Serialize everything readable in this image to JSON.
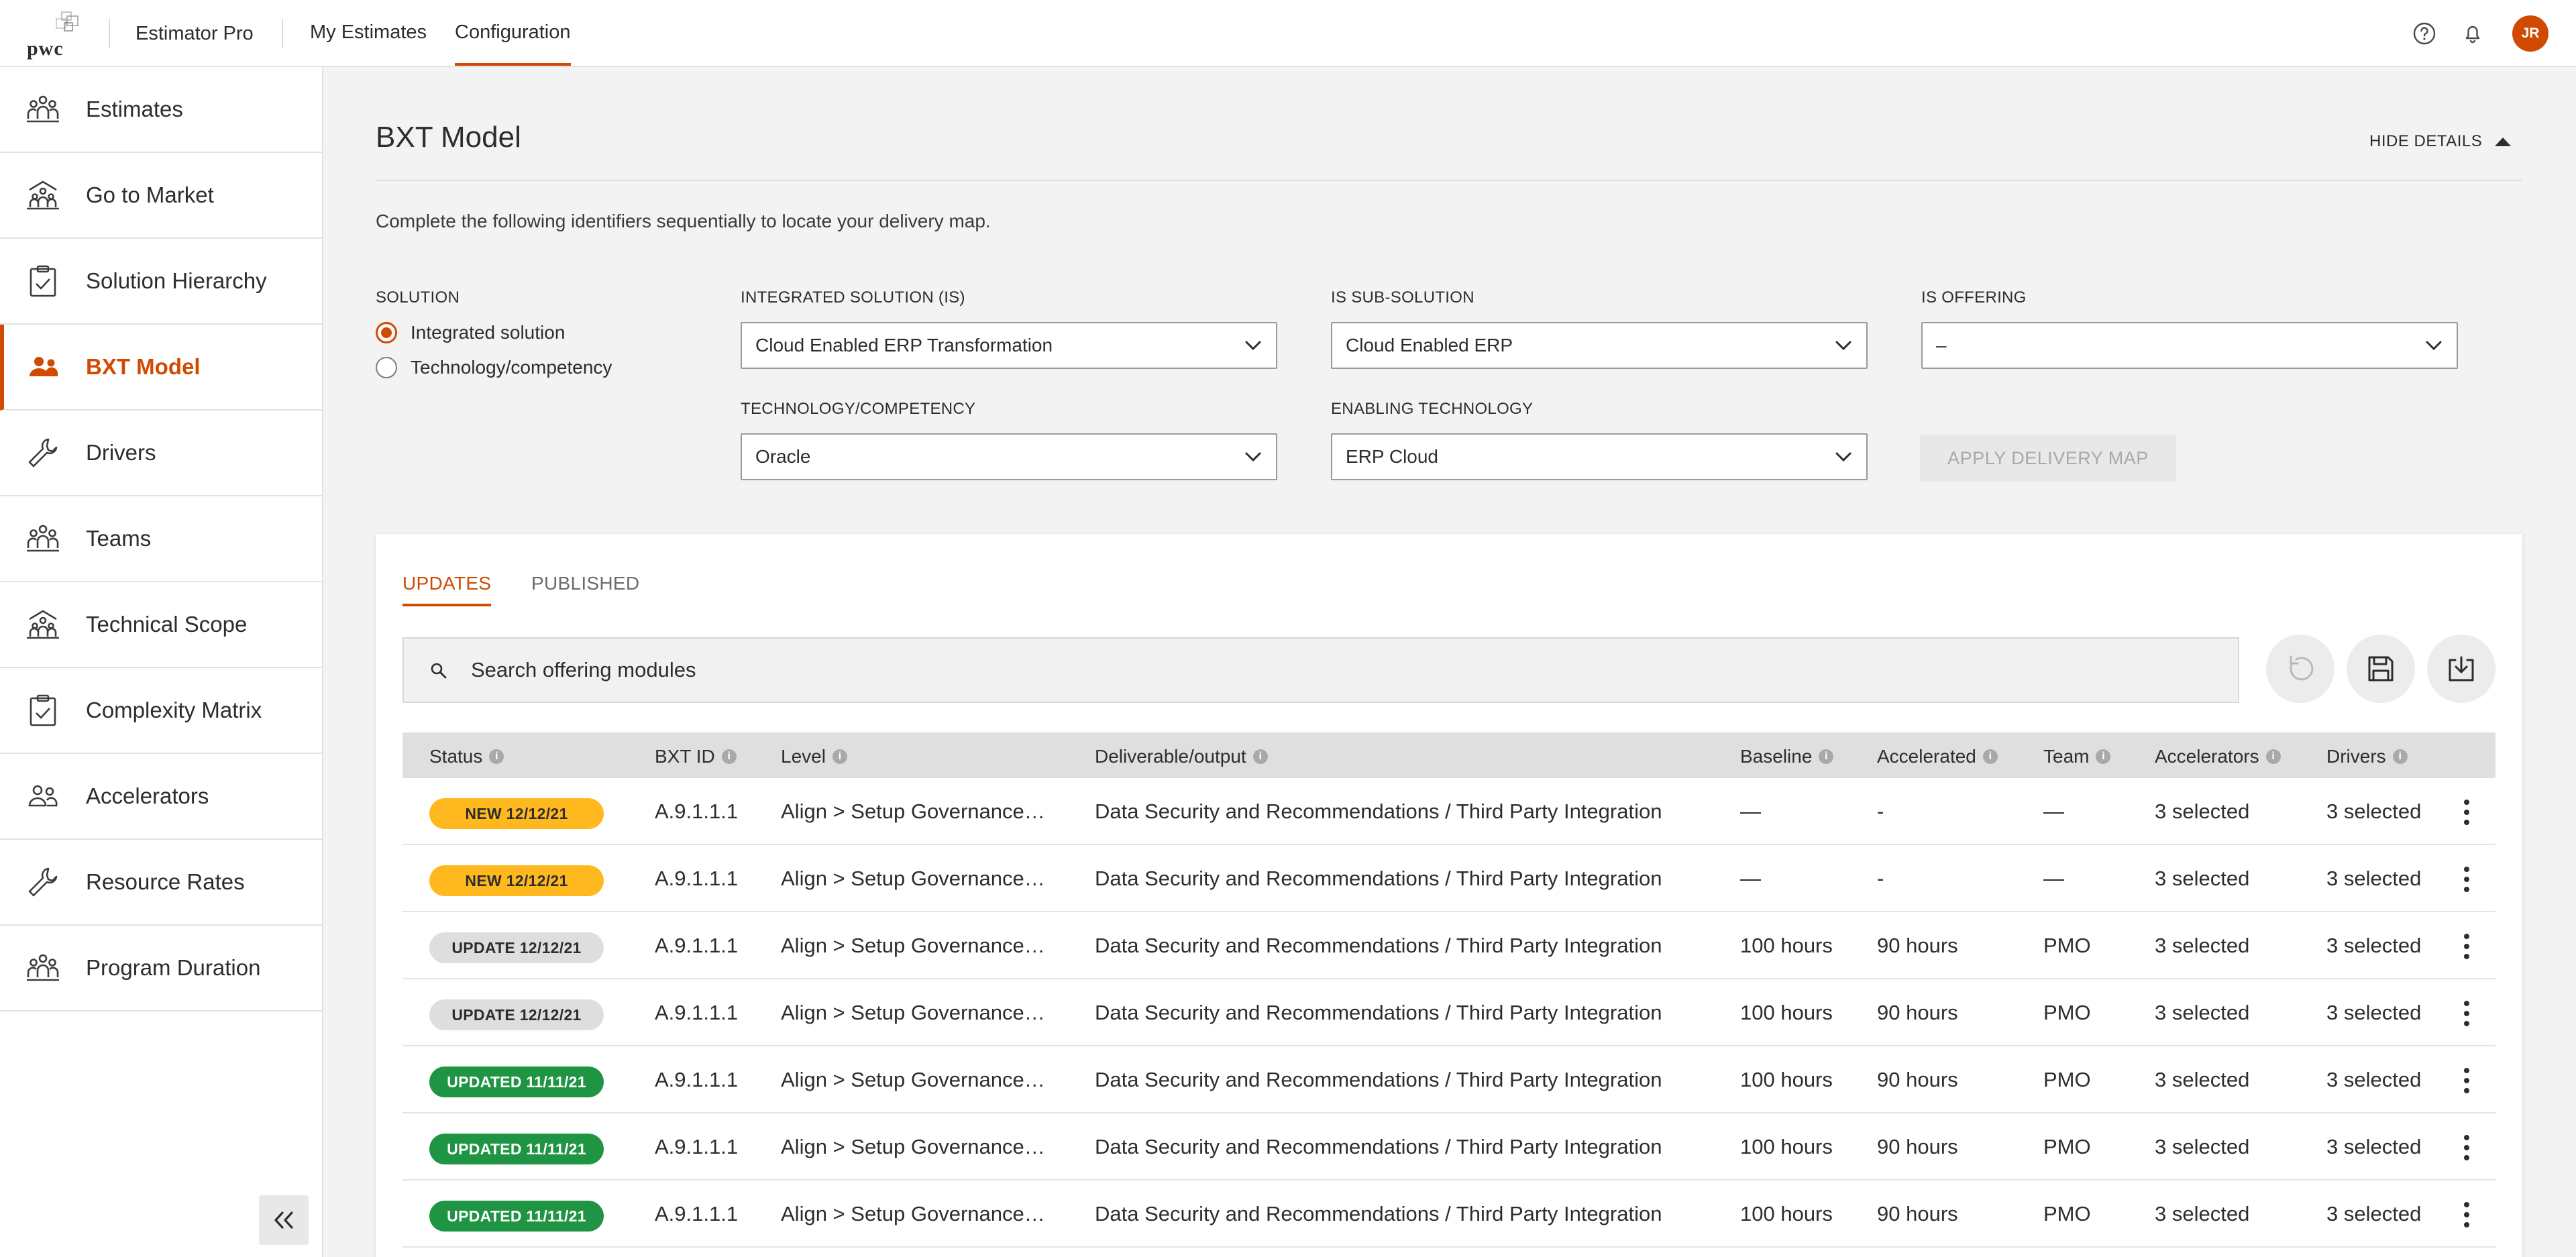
{
  "header": {
    "logo_text": "pwc",
    "app_name": "Estimator Pro",
    "nav": [
      {
        "label": "My Estimates",
        "active": false
      },
      {
        "label": "Configuration",
        "active": true
      }
    ],
    "icons": [
      "help-icon",
      "bell-icon"
    ],
    "user_initials": "JR",
    "accent": "#d04a02"
  },
  "sidebar": {
    "items": [
      {
        "label": "Estimates",
        "icon": "people-group-icon",
        "active": false
      },
      {
        "label": "Go to Market",
        "icon": "building-people-icon",
        "active": false
      },
      {
        "label": "Solution Hierarchy",
        "icon": "clipboard-check-icon",
        "active": false
      },
      {
        "label": "BXT Model",
        "icon": "people-icon",
        "active": true
      },
      {
        "label": "Drivers",
        "icon": "wrench-icon",
        "active": false
      },
      {
        "label": "Teams",
        "icon": "people-group-icon",
        "active": false
      },
      {
        "label": "Technical Scope",
        "icon": "building-people-icon",
        "active": false
      },
      {
        "label": "Complexity Matrix",
        "icon": "clipboard-check-icon",
        "active": false
      },
      {
        "label": "Accelerators",
        "icon": "people-icon",
        "active": false
      },
      {
        "label": "Resource Rates",
        "icon": "wrench-icon",
        "active": false
      },
      {
        "label": "Program Duration",
        "icon": "people-group-icon",
        "active": false
      }
    ],
    "collapse_icon": "double-chevron-left-icon"
  },
  "main": {
    "title": "BXT Model",
    "hide_details_label": "HIDE DETAILS",
    "instructions": "Complete the following identifiers sequentially to locate your delivery map.",
    "solution": {
      "label": "SOLUTION",
      "options": [
        {
          "label": "Integrated solution",
          "selected": true
        },
        {
          "label": "Technology/competency",
          "selected": false
        }
      ]
    },
    "fields": {
      "integrated_solution": {
        "label": "INTEGRATED SOLUTION (IS)",
        "value": "Cloud Enabled ERP Transformation"
      },
      "is_sub_solution": {
        "label": "IS SUB-SOLUTION",
        "value": "Cloud Enabled ERP"
      },
      "is_offering": {
        "label": "IS OFFERING",
        "value": "–"
      },
      "technology_competency": {
        "label": "TECHNOLOGY/COMPETENCY",
        "value": "Oracle"
      },
      "enabling_technology": {
        "label": "ENABLING TECHNOLOGY",
        "value": "ERP Cloud"
      }
    },
    "apply_button": "APPLY DELIVERY MAP"
  },
  "card": {
    "tabs": [
      {
        "label": "UPDATES",
        "active": true
      },
      {
        "label": "PUBLISHED",
        "active": false
      }
    ],
    "search_placeholder": "Search offering modules",
    "actions": [
      "refresh-icon",
      "save-icon",
      "download-icon"
    ],
    "columns": [
      "Status",
      "BXT ID",
      "Level",
      "Deliverable/output",
      "Baseline",
      "Accelerated",
      "Team",
      "Accelerators",
      "Drivers"
    ],
    "rows": [
      {
        "status": "NEW 12/12/21",
        "status_type": "new",
        "id": "A.9.1.1.1",
        "level": "Align > Setup Governance…",
        "deliverable": "Data Security and Recommendations / Third Party Integration",
        "baseline": "—",
        "accelerated": "-",
        "team": "—",
        "accelerators": "3 selected",
        "drivers": "3 selected"
      },
      {
        "status": "NEW 12/12/21",
        "status_type": "new",
        "id": "A.9.1.1.1",
        "level": "Align > Setup Governance…",
        "deliverable": "Data Security and Recommendations / Third Party Integration",
        "baseline": "—",
        "accelerated": "-",
        "team": "—",
        "accelerators": "3 selected",
        "drivers": "3 selected"
      },
      {
        "status": "UPDATE 12/12/21",
        "status_type": "update",
        "id": "A.9.1.1.1",
        "level": "Align > Setup Governance…",
        "deliverable": "Data Security and Recommendations / Third Party Integration",
        "baseline": "100 hours",
        "accelerated": "90 hours",
        "team": "PMO",
        "accelerators": "3 selected",
        "drivers": "3 selected"
      },
      {
        "status": "UPDATE 12/12/21",
        "status_type": "update",
        "id": "A.9.1.1.1",
        "level": "Align > Setup Governance…",
        "deliverable": "Data Security and Recommendations / Third Party Integration",
        "baseline": "100 hours",
        "accelerated": "90 hours",
        "team": "PMO",
        "accelerators": "3 selected",
        "drivers": "3 selected"
      },
      {
        "status": "UPDATED 11/11/21",
        "status_type": "updated",
        "id": "A.9.1.1.1",
        "level": "Align > Setup Governance…",
        "deliverable": "Data Security and Recommendations / Third Party Integration",
        "baseline": "100 hours",
        "accelerated": "90 hours",
        "team": "PMO",
        "accelerators": "3 selected",
        "drivers": "3 selected"
      },
      {
        "status": "UPDATED 11/11/21",
        "status_type": "updated",
        "id": "A.9.1.1.1",
        "level": "Align > Setup Governance…",
        "deliverable": "Data Security and Recommendations / Third Party Integration",
        "baseline": "100 hours",
        "accelerated": "90 hours",
        "team": "PMO",
        "accelerators": "3 selected",
        "drivers": "3 selected"
      },
      {
        "status": "UPDATED 11/11/21",
        "status_type": "updated",
        "id": "A.9.1.1.1",
        "level": "Align > Setup Governance…",
        "deliverable": "Data Security and Recommendations / Third Party Integration",
        "baseline": "100 hours",
        "accelerated": "90 hours",
        "team": "PMO",
        "accelerators": "3 selected",
        "drivers": "3 selected"
      }
    ]
  }
}
